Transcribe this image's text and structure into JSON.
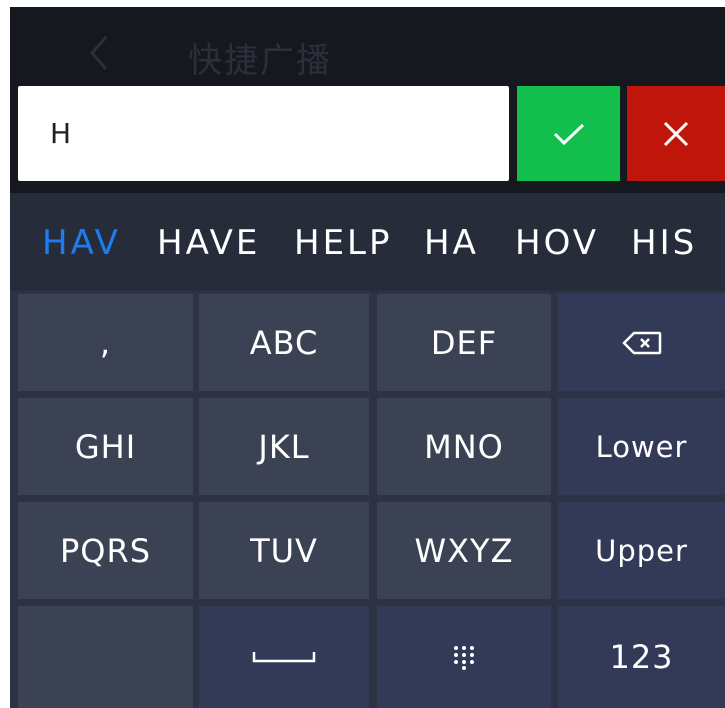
{
  "header": {
    "title": "快捷广播"
  },
  "input": {
    "value": "H"
  },
  "candidates": [
    "HAV",
    "HAVE",
    "HELP",
    "HA",
    "HOV",
    "HIS"
  ],
  "keys": {
    "comma": ",",
    "abc": "ABC",
    "def": "DEF",
    "ghi": "GHI",
    "jkl": "JKL",
    "mno": "MNO",
    "lower": "Lower",
    "pqrs": "PQRS",
    "tuv": "TUV",
    "wxyz": "WXYZ",
    "upper": "Upper",
    "num": "123"
  },
  "icons": {
    "back": "chevron-left-icon",
    "confirm": "check-icon",
    "cancel": "close-icon",
    "backspace": "backspace-icon",
    "space": "space-bar-icon",
    "keypad": "keypad-dots-icon"
  },
  "colors": {
    "active_candidate": "#1e7cf0",
    "confirm": "#12bf4d",
    "cancel": "#c0150b"
  }
}
